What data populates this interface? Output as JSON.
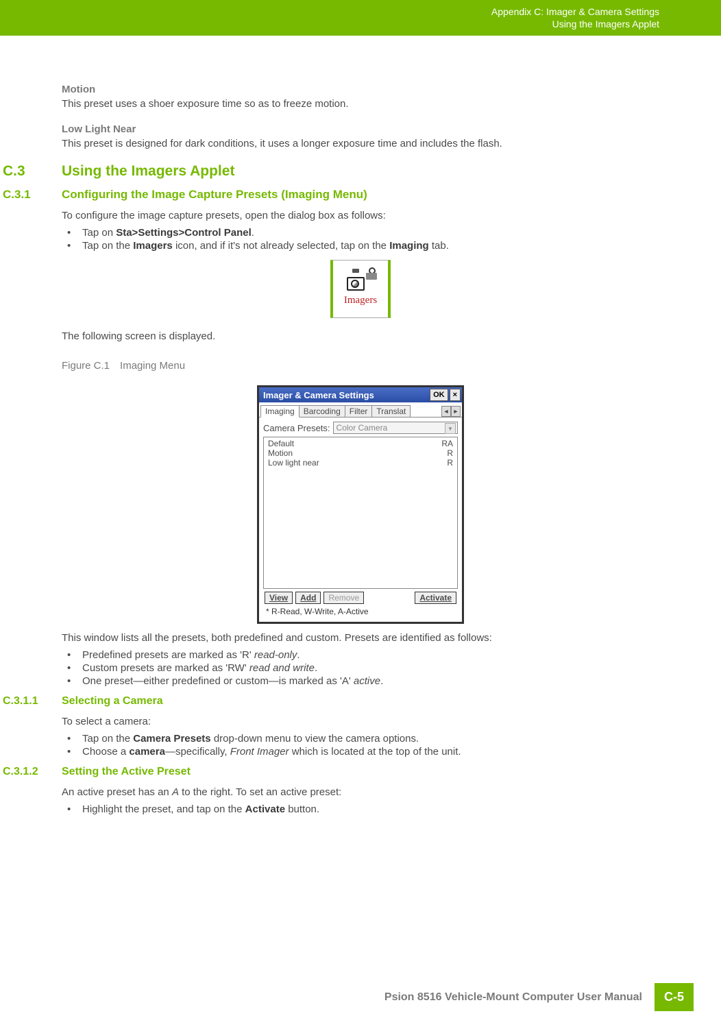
{
  "header": {
    "line1": "Appendix C: Imager & Camera Settings",
    "line2": "Using the Imagers Applet"
  },
  "presets": {
    "motion": {
      "title": "Motion",
      "desc": "This preset uses a shoer exposure time so as to freeze motion."
    },
    "lowlight": {
      "title": "Low Light Near",
      "desc": "This preset is designed for dark conditions, it uses a longer exposure time and includes the flash."
    }
  },
  "sec_c3": {
    "num": "C.3",
    "title": "Using the Imagers Applet"
  },
  "sec_c31": {
    "num": "C.3.1",
    "title": "Configuring the Image Capture Presets (Imaging Menu)",
    "intro": "To configure the image capture presets, open the dialog box as follows:",
    "li1_pre": "Tap on ",
    "li1_bold": "Sta>Settings>Control Panel",
    "li1_post": ".",
    "li2_pre": "Tap on the ",
    "li2_b1": "Imagers",
    "li2_mid": " icon, and if it's not already selected, tap on the ",
    "li2_b2": "Imaging",
    "li2_post": " tab.",
    "after_icon": "The following screen is displayed.",
    "fig_label": "Figure C.1 Imaging Menu",
    "after_fig": "This window lists all the presets, both predefined and custom. Presets are identified as follows:",
    "b1_pre": "Predefined presets are marked as 'R' ",
    "b1_i": "read-only",
    "b1_post": ".",
    "b2_pre": "Custom presets are marked as 'RW' ",
    "b2_i": "read and write",
    "b2_post": ".",
    "b3_pre": "One preset—either predefined or custom—is marked as 'A' ",
    "b3_i": "active",
    "b3_post": "."
  },
  "icon": {
    "label": "Imagers"
  },
  "win": {
    "title": "Imager & Camera Settings",
    "ok": "OK",
    "close": "×",
    "tabs": [
      "Imaging",
      "Barcoding",
      "Filter",
      "Translat"
    ],
    "presets_label": "Camera Presets:",
    "dropdown": "Color Camera",
    "rows": [
      {
        "name": "Default",
        "flag": "RA"
      },
      {
        "name": "Motion",
        "flag": "R"
      },
      {
        "name": "Low light near",
        "flag": "R"
      }
    ],
    "btns": {
      "view": "View",
      "add": "Add",
      "remove": "Remove",
      "activate": "Activate"
    },
    "legend": "* R-Read, W-Write, A-Active"
  },
  "sec_c311": {
    "num": "C.3.1.1",
    "title": "Selecting a Camera",
    "intro": "To select a camera:",
    "li1_pre": "Tap on the ",
    "li1_b": "Camera Presets",
    "li1_post": " drop-down menu to view the camera options.",
    "li2_pre": "Choose a ",
    "li2_b": "camera",
    "li2_mid": "—specifically, ",
    "li2_i": "Front Imager",
    "li2_post": " which is located at the top of the unit."
  },
  "sec_c312": {
    "num": "C.3.1.2",
    "title": "Setting the Active Preset",
    "intro_pre": "An active preset has an ",
    "intro_i": "A",
    "intro_post": " to the right. To set an active preset:",
    "li1_pre": "Highlight the preset, and tap on the ",
    "li1_b": "Activate",
    "li1_post": " button."
  },
  "footer": {
    "manual": "Psion 8516 Vehicle-Mount Computer User Manual",
    "page": "C-5"
  }
}
